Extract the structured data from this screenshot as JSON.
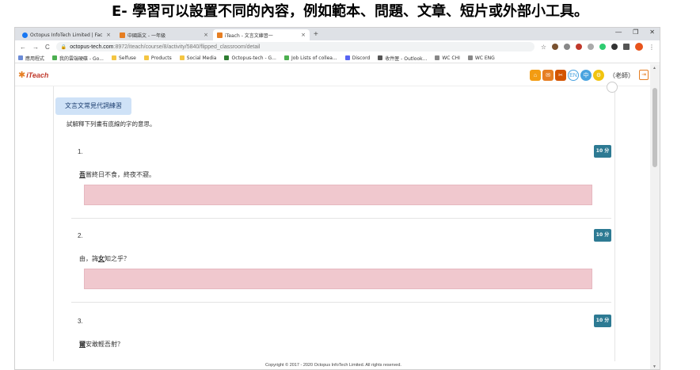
{
  "caption": "E- 學習可以設置不同的內容，例如範本、問題、文章、短片或外部小工具。",
  "browser": {
    "tabs": [
      {
        "label": "Octopus InfoTech Limited | Fac",
        "close": "×"
      },
      {
        "label": "中國語文 - 一年級",
        "close": "×"
      },
      {
        "label": "iTeach - 文言文練習一",
        "close": "×"
      }
    ],
    "new_tab": "+",
    "window_controls": [
      "—",
      "❐",
      "✕"
    ],
    "nav": {
      "back": "←",
      "forward": "→",
      "reload": "C"
    },
    "address": {
      "host": "octopus-tech.com",
      "path": ":8972/iteach/course/8/activity/5840/flipped_classroom/detail"
    },
    "bookmarks": [
      {
        "label": "應用程式",
        "color": "#6b8bd6"
      },
      {
        "label": "我的雲端硬碟 - Go...",
        "color": "#4caf50"
      },
      {
        "label": "Selfuse",
        "color": "#f4c542"
      },
      {
        "label": "Products",
        "color": "#f4c542"
      },
      {
        "label": "Social Media",
        "color": "#f4c542"
      },
      {
        "label": "Octopus-tech - G...",
        "color": "#2e7d32"
      },
      {
        "label": "Job Lists of collea...",
        "color": "#4caf50"
      },
      {
        "label": "Discord",
        "color": "#5865f2"
      },
      {
        "label": "收件匣 - Outlook...",
        "color": "#555555"
      },
      {
        "label": "WC CHI",
        "color": "#888888"
      },
      {
        "label": "WC ENG",
        "color": "#888888"
      }
    ]
  },
  "app": {
    "logo_text": "iTeach",
    "user_label": "（老師）",
    "activity_title": "文言文常見代詞練習",
    "instruction": "試解釋下列畫有底線的字的意思。",
    "footer": "Copyright © 2017 - 2020 Octopus InfoTech Limited. All rights reserved."
  },
  "questions": [
    {
      "number": "1.",
      "score": "10 分",
      "underlined": "吾",
      "rest": "嘗終日不食，終夜不寢。"
    },
    {
      "number": "2.",
      "score": "10 分",
      "prefix": "由，誨",
      "underlined": "女",
      "rest": "知之乎？"
    },
    {
      "number": "3.",
      "score": "10 分",
      "underlined": "爾",
      "rest": "安敢輕吾射？"
    }
  ],
  "colors": {
    "accent": "#2d7a93",
    "activity_badge_bg": "#cfe2f7",
    "answer_box_bg": "#f0c8ce"
  }
}
